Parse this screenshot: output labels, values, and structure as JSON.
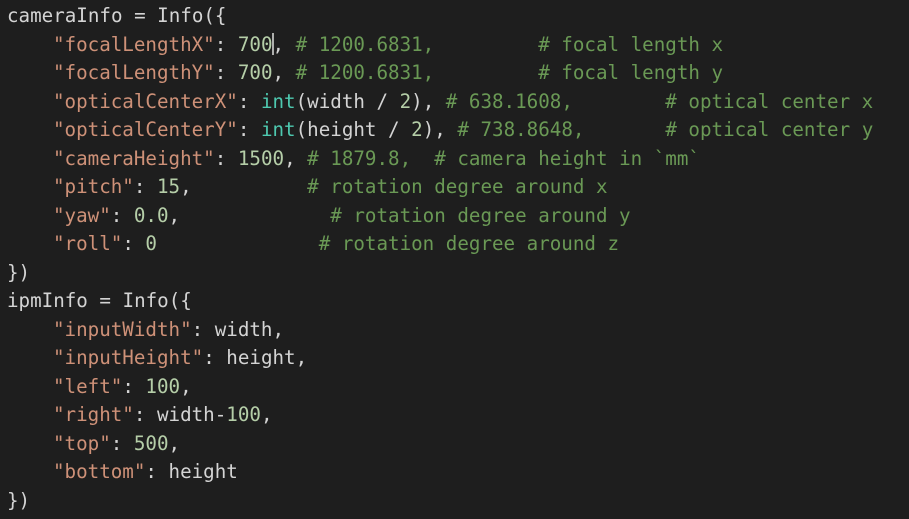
{
  "editor": {
    "lines": [
      [
        {
          "t": "cameraInfo = Info({",
          "c": "plain"
        }
      ],
      [
        {
          "t": "\"focalLengthX\"",
          "c": "str"
        },
        {
          "t": ": ",
          "c": "plain"
        },
        {
          "t": "700",
          "c": "num",
          "cursor": true
        },
        {
          "t": ", ",
          "c": "plain"
        },
        {
          "t": "# 1200.6831,",
          "c": "cmt"
        },
        {
          "t": "         ",
          "c": "plain"
        },
        {
          "t": "# focal length x",
          "c": "cmt"
        }
      ],
      [
        {
          "t": "\"focalLengthY\"",
          "c": "str"
        },
        {
          "t": ": ",
          "c": "plain"
        },
        {
          "t": "700",
          "c": "num"
        },
        {
          "t": ", ",
          "c": "plain"
        },
        {
          "t": "# 1200.6831,",
          "c": "cmt"
        },
        {
          "t": "         ",
          "c": "plain"
        },
        {
          "t": "# focal length y",
          "c": "cmt"
        }
      ],
      [
        {
          "t": "\"opticalCenterX\"",
          "c": "str"
        },
        {
          "t": ": ",
          "c": "plain"
        },
        {
          "t": "int",
          "c": "builtin"
        },
        {
          "t": "(width / ",
          "c": "plain"
        },
        {
          "t": "2",
          "c": "num"
        },
        {
          "t": "), ",
          "c": "plain"
        },
        {
          "t": "# 638.1608,",
          "c": "cmt"
        },
        {
          "t": "        ",
          "c": "plain"
        },
        {
          "t": "# optical center x",
          "c": "cmt"
        }
      ],
      [
        {
          "t": "\"opticalCenterY\"",
          "c": "str"
        },
        {
          "t": ": ",
          "c": "plain"
        },
        {
          "t": "int",
          "c": "builtin"
        },
        {
          "t": "(height / ",
          "c": "plain"
        },
        {
          "t": "2",
          "c": "num"
        },
        {
          "t": "), ",
          "c": "plain"
        },
        {
          "t": "# 738.8648,",
          "c": "cmt"
        },
        {
          "t": "       ",
          "c": "plain"
        },
        {
          "t": "# optical center y",
          "c": "cmt"
        }
      ],
      [
        {
          "t": "\"cameraHeight\"",
          "c": "str"
        },
        {
          "t": ": ",
          "c": "plain"
        },
        {
          "t": "1500",
          "c": "num"
        },
        {
          "t": ", ",
          "c": "plain"
        },
        {
          "t": "# 1879.8,  # camera height in `mm`",
          "c": "cmt"
        }
      ],
      [
        {
          "t": "\"pitch\"",
          "c": "str"
        },
        {
          "t": ": ",
          "c": "plain"
        },
        {
          "t": "15",
          "c": "num"
        },
        {
          "t": ",          ",
          "c": "plain"
        },
        {
          "t": "# rotation degree around x",
          "c": "cmt"
        }
      ],
      [
        {
          "t": "\"yaw\"",
          "c": "str"
        },
        {
          "t": ": ",
          "c": "plain"
        },
        {
          "t": "0.0",
          "c": "num"
        },
        {
          "t": ",             ",
          "c": "plain"
        },
        {
          "t": "# rotation degree around y",
          "c": "cmt"
        }
      ],
      [
        {
          "t": "\"roll\"",
          "c": "str"
        },
        {
          "t": ": ",
          "c": "plain"
        },
        {
          "t": "0",
          "c": "num"
        },
        {
          "t": "              ",
          "c": "plain"
        },
        {
          "t": "# rotation degree around z",
          "c": "cmt"
        }
      ],
      [
        {
          "t": "})",
          "c": "plain"
        }
      ],
      [
        {
          "t": "ipmInfo = Info({",
          "c": "plain"
        }
      ],
      [
        {
          "t": "\"inputWidth\"",
          "c": "str"
        },
        {
          "t": ": width,",
          "c": "plain"
        }
      ],
      [
        {
          "t": "\"inputHeight\"",
          "c": "str"
        },
        {
          "t": ": height,",
          "c": "plain"
        }
      ],
      [
        {
          "t": "\"left\"",
          "c": "str"
        },
        {
          "t": ": ",
          "c": "plain"
        },
        {
          "t": "100",
          "c": "num"
        },
        {
          "t": ",",
          "c": "plain"
        }
      ],
      [
        {
          "t": "\"right\"",
          "c": "str"
        },
        {
          "t": ": width-",
          "c": "plain"
        },
        {
          "t": "100",
          "c": "num"
        },
        {
          "t": ",",
          "c": "plain"
        }
      ],
      [
        {
          "t": "\"top\"",
          "c": "str"
        },
        {
          "t": ": ",
          "c": "plain"
        },
        {
          "t": "500",
          "c": "num"
        },
        {
          "t": ",",
          "c": "plain"
        }
      ],
      [
        {
          "t": "\"bottom\"",
          "c": "str"
        },
        {
          "t": ": height",
          "c": "plain"
        }
      ],
      [
        {
          "t": "})",
          "c": "plain"
        }
      ]
    ],
    "indented": [
      false,
      true,
      true,
      true,
      true,
      true,
      true,
      true,
      true,
      false,
      false,
      true,
      true,
      true,
      true,
      true,
      true,
      false
    ],
    "active_block": [
      1,
      8
    ],
    "colors": {
      "background": "#1e1e1e",
      "string": "#ce9178",
      "number": "#b5cea8",
      "comment": "#6a9955",
      "builtin": "#4ec9b0",
      "text": "#d4d4d4"
    }
  }
}
